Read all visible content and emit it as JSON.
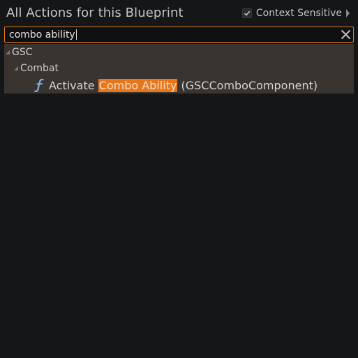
{
  "header": {
    "title": "All Actions for this Blueprint",
    "context_label": "Context Sensitive",
    "context_checked": true
  },
  "search": {
    "value": "combo ability",
    "clear_icon": "close-icon"
  },
  "tree": {
    "category": "GSC",
    "subcategory": "Combat",
    "action": {
      "icon": "function-icon",
      "prefix": "Activate ",
      "highlight": "Combo Ability",
      "suffix": " (GSCComboComponent)"
    }
  },
  "colors": {
    "highlight": "#e8761a",
    "search_border": "#e07a1f",
    "tree_bg": "#3a3431"
  }
}
